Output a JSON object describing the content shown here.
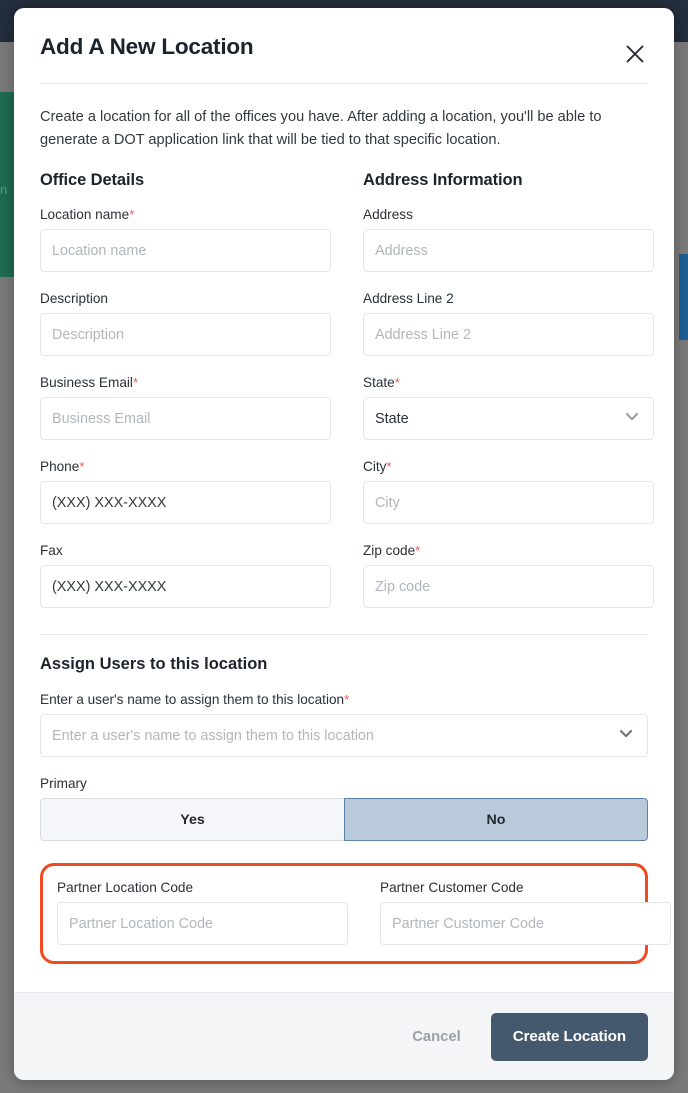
{
  "background": {
    "topbar_color": "#232d3b",
    "green_rail_color": "#1d6b4f",
    "green_rail_text": "n",
    "blue_rail_color": "#1e5f94",
    "overlay_color": "#7a7a7a"
  },
  "modal": {
    "title": "Add A New Location",
    "close_icon": "close-icon",
    "intro": "Create a location for all of the offices you have. After adding a location, you'll be able to generate a DOT application link that will be tied to that specific location.",
    "office_details": {
      "section_title": "Office Details",
      "fields": [
        {
          "label": "Location name",
          "required": true,
          "placeholder": "Location name",
          "value": "",
          "type": "text"
        },
        {
          "label": "Description",
          "required": false,
          "placeholder": "Description",
          "value": "",
          "type": "text"
        },
        {
          "label": "Business Email",
          "required": true,
          "placeholder": "Business Email",
          "value": "",
          "type": "text"
        },
        {
          "label": "Phone",
          "required": true,
          "placeholder": "",
          "value": "(XXX) XXX-XXXX",
          "type": "text"
        },
        {
          "label": "Fax",
          "required": false,
          "placeholder": "",
          "value": "(XXX) XXX-XXXX",
          "type": "text"
        }
      ]
    },
    "address_information": {
      "section_title": "Address Information",
      "fields": [
        {
          "label": "Address",
          "required": false,
          "placeholder": "Address",
          "value": "",
          "type": "text"
        },
        {
          "label": "Address Line 2",
          "required": false,
          "placeholder": "Address Line 2",
          "value": "",
          "type": "text"
        },
        {
          "label": "State",
          "required": true,
          "placeholder": "State",
          "value": "State",
          "type": "select"
        },
        {
          "label": "City",
          "required": true,
          "placeholder": "City",
          "value": "",
          "type": "text"
        },
        {
          "label": "Zip code",
          "required": true,
          "placeholder": "Zip code",
          "value": "",
          "type": "text"
        }
      ]
    },
    "assign_users": {
      "section_title": "Assign Users to this location",
      "user_field": {
        "label": "Enter a user's name to assign them to this location",
        "required": true,
        "placeholder": "Enter a user's name to assign them to this location",
        "value": ""
      },
      "primary": {
        "label": "Primary",
        "options": [
          {
            "label": "Yes",
            "selected": false
          },
          {
            "label": "No",
            "selected": true
          }
        ],
        "selected_bg": "#b9cbdb",
        "selected_border": "#5d83a8"
      }
    },
    "partner_section": {
      "highlight_color": "#f04a20",
      "fields": [
        {
          "label": "Partner Location Code",
          "required": false,
          "placeholder": "Partner Location Code",
          "value": ""
        },
        {
          "label": "Partner Customer Code",
          "required": false,
          "placeholder": "Partner Customer Code",
          "value": ""
        }
      ]
    },
    "footer": {
      "cancel_label": "Cancel",
      "submit_label": "Create Location",
      "submit_color": "#45596e"
    }
  }
}
